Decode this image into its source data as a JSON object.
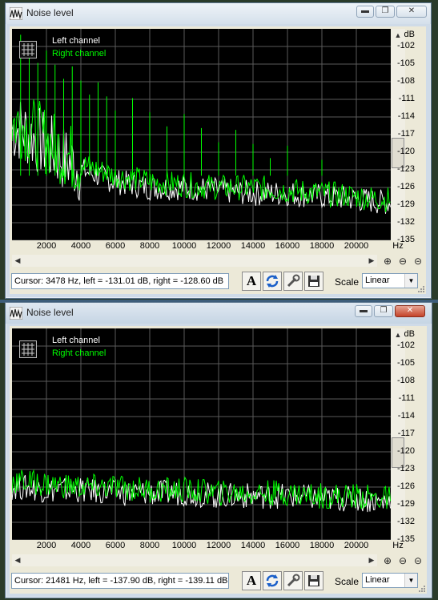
{
  "windows": [
    {
      "title": "Noise level",
      "legend": {
        "left": "Left channel",
        "right": "Right channel"
      },
      "db_unit": "dB",
      "db_ticks": [
        "-102",
        "-105",
        "-108",
        "-111",
        "-114",
        "-117",
        "-120",
        "-123",
        "-126",
        "-129",
        "-132",
        "-135"
      ],
      "hz_unit": "Hz",
      "hz_ticks": [
        "2000",
        "4000",
        "6000",
        "8000",
        "10000",
        "12000",
        "14000",
        "16000",
        "18000",
        "20000"
      ],
      "cursor_text": "Cursor:  3478 Hz,  left = -131.01 dB,  right = -128.60 dB",
      "scale_label": "Scale",
      "scale_value": "Linear",
      "icon_names": [
        "minimize-icon",
        "restore-icon",
        "close-icon",
        "font-icon",
        "refresh-icon",
        "properties-icon",
        "save-icon",
        "zoom-in-icon",
        "zoom-out-icon",
        "zoom-reset-icon"
      ]
    },
    {
      "title": "Noise level",
      "legend": {
        "left": "Left channel",
        "right": "Right channel"
      },
      "db_unit": "dB",
      "db_ticks": [
        "-102",
        "-105",
        "-108",
        "-111",
        "-114",
        "-117",
        "-120",
        "-123",
        "-126",
        "-129",
        "-132",
        "-135"
      ],
      "hz_unit": "Hz",
      "hz_ticks": [
        "2000",
        "4000",
        "6000",
        "8000",
        "10000",
        "12000",
        "14000",
        "16000",
        "18000",
        "20000"
      ],
      "cursor_text": "Cursor:  21481 Hz,  left = -137.90 dB,  right = -139.11 dB",
      "scale_label": "Scale",
      "scale_value": "Linear"
    }
  ],
  "colors": {
    "left_channel": "#ffffff",
    "right_channel": "#00ff00",
    "grid": "#5a5a5a",
    "plot_bg": "#000000"
  },
  "chart_data": [
    {
      "type": "line",
      "xlabel": "Hz",
      "ylabel": "dB",
      "xlim": [
        0,
        22000
      ],
      "ylim": [
        -135,
        -99
      ],
      "series": [
        {
          "name": "Left channel",
          "x": [
            500,
            2000,
            4000,
            6000,
            8000,
            10000,
            12000,
            14000,
            16000,
            18000,
            20000,
            21500
          ],
          "values": [
            -116,
            -119,
            -123,
            -125,
            -126,
            -126,
            -126.5,
            -127,
            -127,
            -127.5,
            -128,
            -128.5
          ]
        },
        {
          "name": "Right channel",
          "x": [
            500,
            2000,
            4000,
            6000,
            8000,
            10000,
            12000,
            14000,
            16000,
            18000,
            20000,
            21500
          ],
          "values": [
            -115,
            -118,
            -122,
            -124,
            -125,
            -125.5,
            -126,
            -126,
            -126.5,
            -127,
            -127.5,
            -128
          ]
        }
      ]
    },
    {
      "type": "line",
      "xlabel": "Hz",
      "ylabel": "dB",
      "xlim": [
        0,
        22000
      ],
      "ylim": [
        -135,
        -99
      ],
      "series": [
        {
          "name": "Left channel",
          "x": [
            500,
            2000,
            4000,
            6000,
            8000,
            10000,
            12000,
            14000,
            16000,
            18000,
            20000,
            21500
          ],
          "values": [
            -126,
            -126.5,
            -126.5,
            -127,
            -127,
            -127,
            -127.5,
            -127.5,
            -127.5,
            -128,
            -128,
            -128.5
          ]
        },
        {
          "name": "Right channel",
          "x": [
            500,
            2000,
            4000,
            6000,
            8000,
            10000,
            12000,
            14000,
            16000,
            18000,
            20000,
            21500
          ],
          "values": [
            -125,
            -125.5,
            -126,
            -126,
            -126.5,
            -126.5,
            -127,
            -127,
            -127,
            -127.5,
            -127.5,
            -128
          ]
        }
      ]
    }
  ]
}
